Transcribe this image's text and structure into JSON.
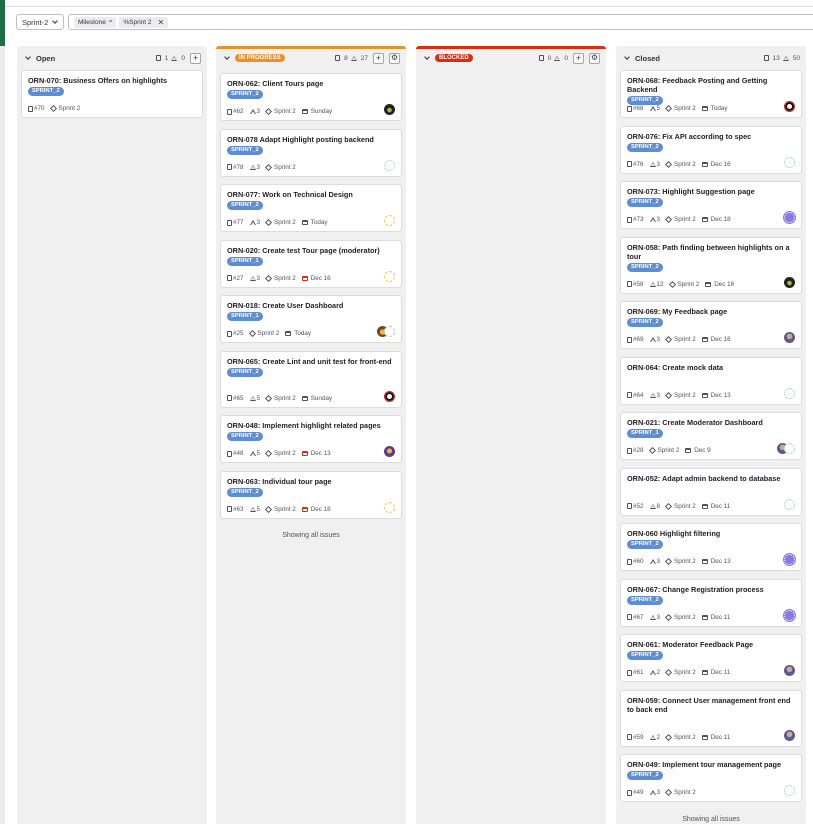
{
  "toolbar": {
    "sprint_select": "Sprint-2",
    "filter_tokens": [
      {
        "label": "Milestone",
        "operator": "="
      },
      {
        "label": "%Sprint 2"
      }
    ]
  },
  "colors": {
    "in_progress": "#e8912e",
    "blocked": "#dd2b0e",
    "label": "#5f8dd3"
  },
  "columns": [
    {
      "title": "Open",
      "issue_count": "1",
      "weight": "0",
      "cards": [
        {
          "title": "ORN-070: Business Offers on highlights",
          "label": "SPRINT_2",
          "number": "#70",
          "weight": "",
          "milestone": "Sprint 2",
          "due": "",
          "avatar": ""
        }
      ],
      "footer": ""
    },
    {
      "title": "IN PROGRESS",
      "issue_count": "8",
      "weight": "27",
      "cards": [
        {
          "title": "ORN-062: Client Tours page",
          "label": "SPRINT_2",
          "number": "#62",
          "weight": "3",
          "milestone": "Sprint 2",
          "due": "Sunday",
          "avatar": "dark"
        },
        {
          "title": "ORN-078 Adapt Highlight posting backend",
          "label": "SPRINT_2",
          "number": "#78",
          "weight": "3",
          "milestone": "Sprint 2",
          "due": "",
          "avatar": "green"
        },
        {
          "title": "ORN-077: Work on Technical Design",
          "label": "SPRINT_2",
          "number": "#77",
          "weight": "3",
          "milestone": "Sprint 2",
          "due": "Today",
          "avatar": "yellow"
        },
        {
          "title": "ORN-020: Create test Tour page (moderator)",
          "label": "SPRINT_1",
          "number": "#27",
          "weight": "3",
          "milestone": "Sprint 2",
          "due": "Dec 16",
          "due_overdue": true,
          "avatar": "yellow"
        },
        {
          "title": "ORN-018: Create User Dashboard",
          "label": "SPRINT_1",
          "number": "#25",
          "weight": "",
          "milestone": "Sprint 2",
          "due": "Today",
          "avatar": "multi2"
        },
        {
          "title": "ORN-065: Create Lint and unit test for front-end",
          "label": "SPRINT_2",
          "number": "#65",
          "weight": "5",
          "milestone": "Sprint 2",
          "due": "Sunday",
          "avatar": "red"
        },
        {
          "title": "ORN-048: Implement highlight related pages",
          "label": "SPRINT_2",
          "number": "#48",
          "weight": "5",
          "milestone": "Sprint 2",
          "due": "Dec 13",
          "due_overdue": true,
          "avatar": "orange"
        },
        {
          "title": "ORN-063: Individual tour page",
          "label": "SPRINT_2",
          "number": "#63",
          "weight": "5",
          "milestone": "Sprint 2",
          "due": "Dec 18",
          "due_overdue": true,
          "avatar": "yellow"
        }
      ],
      "footer": "Showing all issues"
    },
    {
      "title": "BLOCKED",
      "issue_count": "0",
      "weight": "0",
      "cards": [],
      "footer": ""
    },
    {
      "title": "Closed",
      "issue_count": "13",
      "weight": "50",
      "cards": [
        {
          "title": "ORN-068: Feedback Posting and Getting Backend",
          "label": "SPRINT_2",
          "number": "#68",
          "weight": "5",
          "milestone": "Sprint 2",
          "due": "Today",
          "avatar": "red"
        },
        {
          "title": "ORN-076: Fix API according to spec",
          "label": "SPRINT_2",
          "number": "#76",
          "weight": "3",
          "milestone": "Sprint 2",
          "due": "Dec 16",
          "avatar": "green"
        },
        {
          "title": "ORN-073: Highlight Suggestion page",
          "label": "SPRINT_2",
          "number": "#73",
          "weight": "3",
          "milestone": "Sprint 2",
          "due": "Dec 18",
          "avatar": "purple"
        },
        {
          "title": "ORN-058: Path finding between highlights on a tour",
          "label": "SPRINT_2",
          "number": "#58",
          "weight": "12",
          "milestone": "Sprint 2",
          "due": "Dec 16",
          "avatar": "dark"
        },
        {
          "title": "ORN-069: My Feedback page",
          "label": "SPRINT_2",
          "number": "#69",
          "weight": "3",
          "milestone": "Sprint 2",
          "due": "Dec 16",
          "avatar": "photo"
        },
        {
          "title": "ORN-064: Create mock data",
          "label": "",
          "number": "#64",
          "weight": "3",
          "milestone": "Sprint 2",
          "due": "Dec 13",
          "avatar": "green"
        },
        {
          "title": "ORN-021: Create Moderator Dashboard",
          "label": "SPRINT_1",
          "number": "#28",
          "weight": "",
          "milestone": "Sprint 2",
          "due": "Dec 9",
          "avatar": "multi1"
        },
        {
          "title": "ORN-052: Adapt admin backend to database",
          "label": "",
          "number": "#52",
          "weight": "8",
          "milestone": "Sprint 2",
          "due": "Dec 11",
          "avatar": "green"
        },
        {
          "title": "ORN-060 Highlight filtering",
          "label": "SPRINT_2",
          "number": "#60",
          "weight": "3",
          "milestone": "Sprint 2",
          "due": "Dec 13",
          "avatar": "purple"
        },
        {
          "title": "ORN-067: Change Registration process",
          "label": "SPRINT_2",
          "number": "#67",
          "weight": "3",
          "milestone": "Sprint 2",
          "due": "Dec 11",
          "avatar": "purple"
        },
        {
          "title": "ORN-061: Moderator Feedback Page",
          "label": "SPRINT_2",
          "number": "#61",
          "weight": "2",
          "milestone": "Sprint 2",
          "due": "Dec 11",
          "avatar": "photo"
        },
        {
          "title": "ORN-059: Connect User management front end to back end",
          "label": "",
          "number": "#59",
          "weight": "2",
          "milestone": "Sprint 2",
          "due": "Dec 11",
          "avatar": "photo"
        },
        {
          "title": "ORN-049: Implement tour management page",
          "label": "SPRINT_2",
          "number": "#49",
          "weight": "3",
          "milestone": "Sprint 2",
          "due": "",
          "avatar": "green"
        }
      ],
      "footer": "Showing all issues"
    }
  ]
}
